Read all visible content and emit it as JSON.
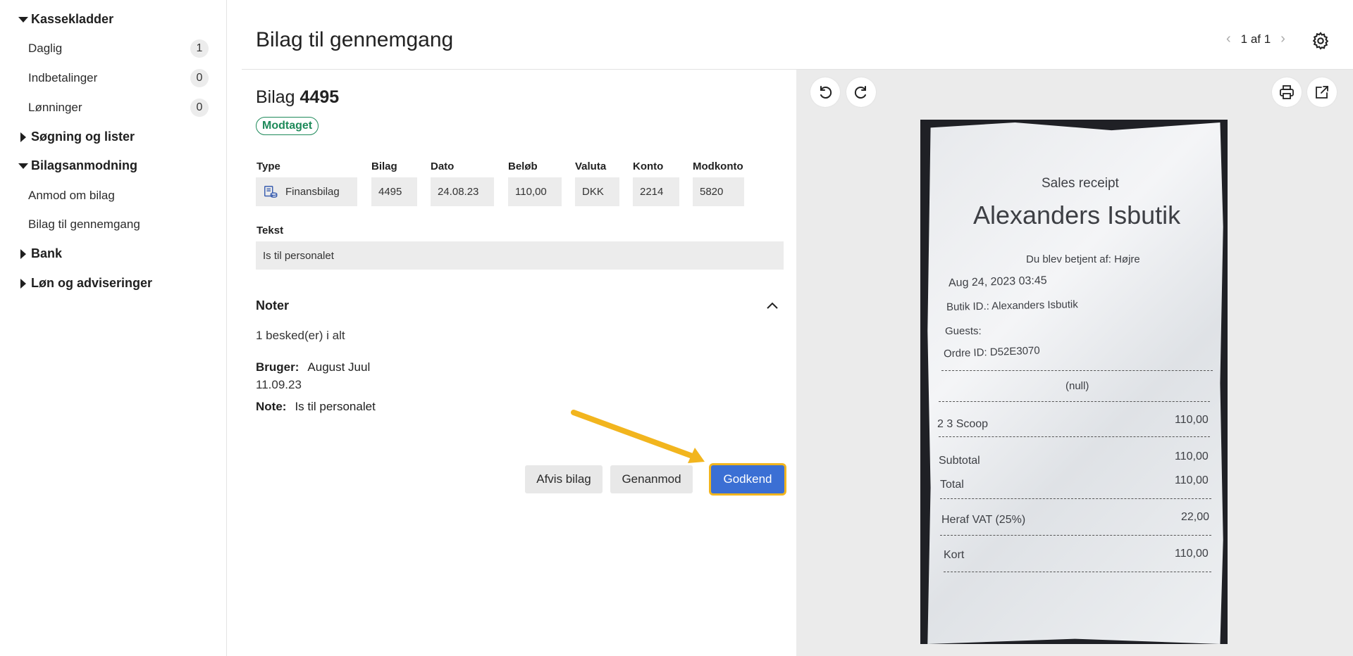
{
  "sidebar": {
    "groups": [
      {
        "label": "Kassekladder",
        "expanded": true
      },
      {
        "label": "Søgning og lister",
        "expanded": false
      },
      {
        "label": "Bilagsanmodning",
        "expanded": true
      },
      {
        "label": "Bank",
        "expanded": false
      },
      {
        "label": "Løn og adviseringer",
        "expanded": false
      }
    ],
    "items": [
      {
        "label": "Daglig",
        "count": "1"
      },
      {
        "label": "Indbetalinger",
        "count": "0"
      },
      {
        "label": "Lønninger",
        "count": "0"
      },
      {
        "label": "Anmod om bilag"
      },
      {
        "label": "Bilag til gennemgang"
      }
    ]
  },
  "header": {
    "title": "Bilag til gennemgang",
    "pager": "1 af 1"
  },
  "voucher": {
    "prefix": "Bilag",
    "number": "4495",
    "status": "Modtaget",
    "fields": {
      "type": {
        "label": "Type",
        "value": "Finansbilag"
      },
      "bilag": {
        "label": "Bilag",
        "value": "4495"
      },
      "dato": {
        "label": "Dato",
        "value": "24.08.23"
      },
      "belob": {
        "label": "Beløb",
        "value": "110,00"
      },
      "valuta": {
        "label": "Valuta",
        "value": "DKK"
      },
      "konto": {
        "label": "Konto",
        "value": "2214"
      },
      "modkonto": {
        "label": "Modkonto",
        "value": "5820"
      }
    },
    "tekst": {
      "label": "Tekst",
      "value": "Is til personalet"
    }
  },
  "notes": {
    "title": "Noter",
    "count_text": "1 besked(er) i alt",
    "user_label": "Bruger:",
    "user": "August Juul",
    "date": "11.09.23",
    "note_label": "Note:",
    "note": "Is til personalet"
  },
  "actions": {
    "reject": "Afvis bilag",
    "rerequest": "Genanmod",
    "approve": "Godkend"
  },
  "colors": {
    "accent": "#3b6fd4",
    "highlight": "#f2b51e",
    "status": "#1e8a5a"
  },
  "receipt": {
    "heading": "Sales receipt",
    "shop": "Alexanders Isbutik",
    "served_by": "Du blev betjent af: Højre",
    "datetime": "Aug 24, 2023 03:45",
    "shop_id": "Butik ID.: Alexanders Isbutik",
    "guests": "Guests:",
    "order_id": "Ordre ID: D52E3070",
    "null": "(null)",
    "line_item": "2   3 Scoop",
    "line_amount": "110,00",
    "subtotal_label": "Subtotal",
    "subtotal": "110,00",
    "total_label": "Total",
    "total": "110,00",
    "vat_label": "Heraf VAT (25%)",
    "vat": "22,00",
    "card_label": "Kort",
    "card": "110,00"
  }
}
